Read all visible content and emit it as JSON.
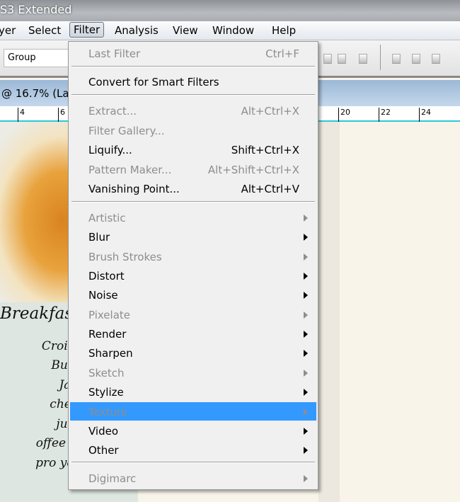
{
  "window": {
    "title": "S3 Extended"
  },
  "menubar": [
    "yer",
    "Select",
    "Filter",
    "Analysis",
    "View",
    "Window",
    "Help"
  ],
  "options": {
    "group_select": "Group"
  },
  "document": {
    "tab_title": "@ 16.7% (La"
  },
  "ruler": [
    "4",
    "6",
    "20",
    "22",
    "24"
  ],
  "canvas_text": {
    "heading": "Breakfast",
    "items": [
      "Croissant",
      "Butter",
      "Jam",
      "cheese",
      "juice",
      "offee or tea",
      "pro yogurt*"
    ]
  },
  "filter_menu": {
    "last_filter": {
      "label": "Last Filter",
      "shortcut": "Ctrl+F"
    },
    "convert": {
      "label": "Convert for Smart Filters"
    },
    "group1": [
      {
        "label": "Extract...",
        "shortcut": "Alt+Ctrl+X",
        "disabled": true
      },
      {
        "label": "Filter Gallery...",
        "shortcut": "",
        "disabled": true
      },
      {
        "label": "Liquify...",
        "shortcut": "Shift+Ctrl+X",
        "disabled": false
      },
      {
        "label": "Pattern Maker...",
        "shortcut": "Alt+Shift+Ctrl+X",
        "disabled": true
      },
      {
        "label": "Vanishing Point...",
        "shortcut": "Alt+Ctrl+V",
        "disabled": false
      }
    ],
    "submenus": [
      {
        "label": "Artistic",
        "disabled": true
      },
      {
        "label": "Blur",
        "disabled": false
      },
      {
        "label": "Brush Strokes",
        "disabled": true
      },
      {
        "label": "Distort",
        "disabled": false
      },
      {
        "label": "Noise",
        "disabled": false
      },
      {
        "label": "Pixelate",
        "disabled": true
      },
      {
        "label": "Render",
        "disabled": false
      },
      {
        "label": "Sharpen",
        "disabled": false
      },
      {
        "label": "Sketch",
        "disabled": true
      },
      {
        "label": "Stylize",
        "disabled": false
      },
      {
        "label": "Texture",
        "disabled": true,
        "highlighted": true
      },
      {
        "label": "Video",
        "disabled": false
      },
      {
        "label": "Other",
        "disabled": false
      }
    ],
    "digimarc": {
      "label": "Digimarc",
      "disabled": true
    }
  },
  "colors": {
    "highlight": "#3399ff",
    "menu_bg": "#f0f0f0",
    "canvas_bg": "#f8f4ea"
  }
}
